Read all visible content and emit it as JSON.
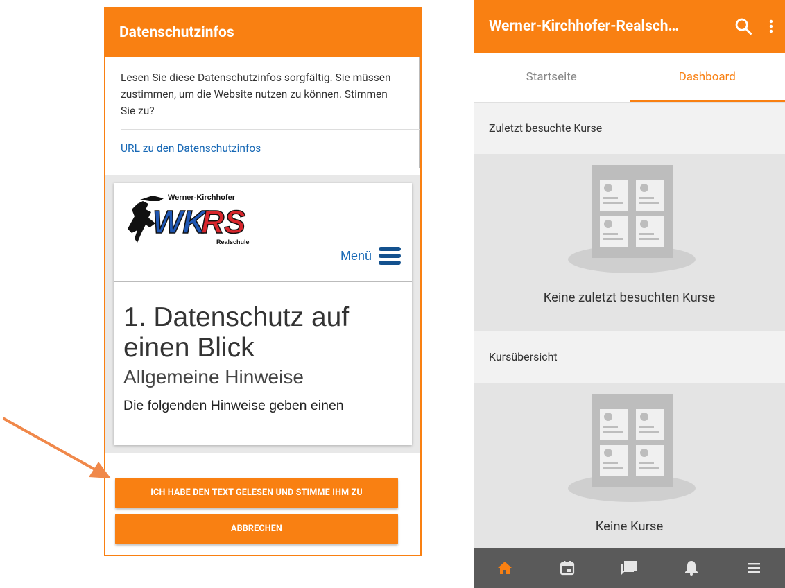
{
  "left": {
    "header_title": "Datenschutzinfos",
    "intro_text": "Lesen Sie diese Datenschutzinfos sorgfältig. Sie müssen zustimmen, um die Website nutzen zu können. Stimmen Sie zu?",
    "link_text": "URL zu den Datenschutzinfos",
    "webpage": {
      "logo_text_top": "Werner-Kirchhofer",
      "logo_letters": "WKRS",
      "logo_text_bottom": "Realschule",
      "menu_label": "Menü",
      "heading1": "1. Datenschutz auf einen Blick",
      "heading2": "Allgemeine Hinweise",
      "paragraph": "Die folgenden Hinweise geben einen"
    },
    "accept_button": "ICH HABE DEN TEXT GELESEN UND STIMME IHM ZU",
    "cancel_button": "ABBRECHEN"
  },
  "right": {
    "app_title": "Werner-Kirchhofer-Realsch…",
    "tabs": [
      {
        "label": "Startseite",
        "active": false
      },
      {
        "label": "Dashboard",
        "active": true
      }
    ],
    "recent_section": {
      "title": "Zuletzt besuchte Kurse",
      "empty_text": "Keine zuletzt besuchten Kurse"
    },
    "overview_section": {
      "title": "Kursübersicht",
      "empty_text": "Keine Kurse"
    },
    "bottom_nav_icons": [
      "home-icon",
      "calendar-icon",
      "messages-icon",
      "notifications-icon",
      "more-menu-icon"
    ]
  },
  "colors": {
    "accent": "#f98012",
    "link": "#1768b5",
    "nav_bg": "#5a5a5a"
  }
}
